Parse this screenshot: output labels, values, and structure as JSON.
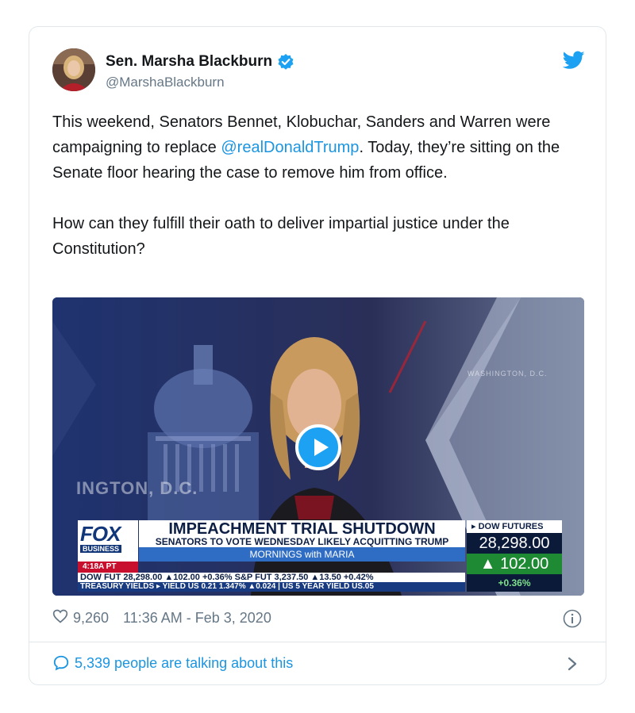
{
  "author": {
    "name": "Sen. Marsha Blackburn",
    "handle": "@MarshaBlackburn"
  },
  "tweet": {
    "text_part1": "This weekend, Senators Bennet, Klobuchar, Sanders and Warren were campaigning to replace ",
    "mention": "@realDonaldTrump",
    "text_part2": ". Today, they’re sitting on the Senate floor hearing the case to remove him from office.",
    "paragraph2": "How can they fulfill their oath to deliver impartial justice under the Constitution?"
  },
  "video": {
    "watermark_left": "INGTON, D.C.",
    "watermark_right": "WASHINGTON, D.C.",
    "network": "FOX",
    "network_sub": "BUSINESS",
    "time": "4:18A PT",
    "headline": "IMPEACHMENT TRIAL SHUTDOWN",
    "subheadline": "SENATORS TO VOTE WEDNESDAY LIKELY ACQUITTING TRUMP",
    "show": "MORNINGS with MARIA",
    "ticker1": "DOW FUT 28,298.00 ▲102.00 +0.36% S&P FUT 3,237.50 ▲13.50 +0.42%",
    "ticker2": "TREASURY YIELDS ▸ YIELD US 0.21 1.347% ▲0.024 | US 5 YEAR YIELD US.05",
    "dow_label": "▸ DOW FUTURES",
    "dow_value": "28,298.00",
    "dow_change": "▲ 102.00",
    "dow_pct": "+0.36%"
  },
  "meta": {
    "likes": "9,260",
    "timestamp": "11:36 AM - Feb 3, 2020"
  },
  "talking": "5,339 people are talking about this",
  "colors": {
    "link": "#1b95e0",
    "verified": "#1da1f2",
    "muted": "#657786"
  },
  "icons": [
    "verified-badge-icon",
    "twitter-bird-icon",
    "play-icon",
    "heart-icon",
    "info-icon",
    "speech-bubble-icon",
    "chevron-right-icon"
  ]
}
